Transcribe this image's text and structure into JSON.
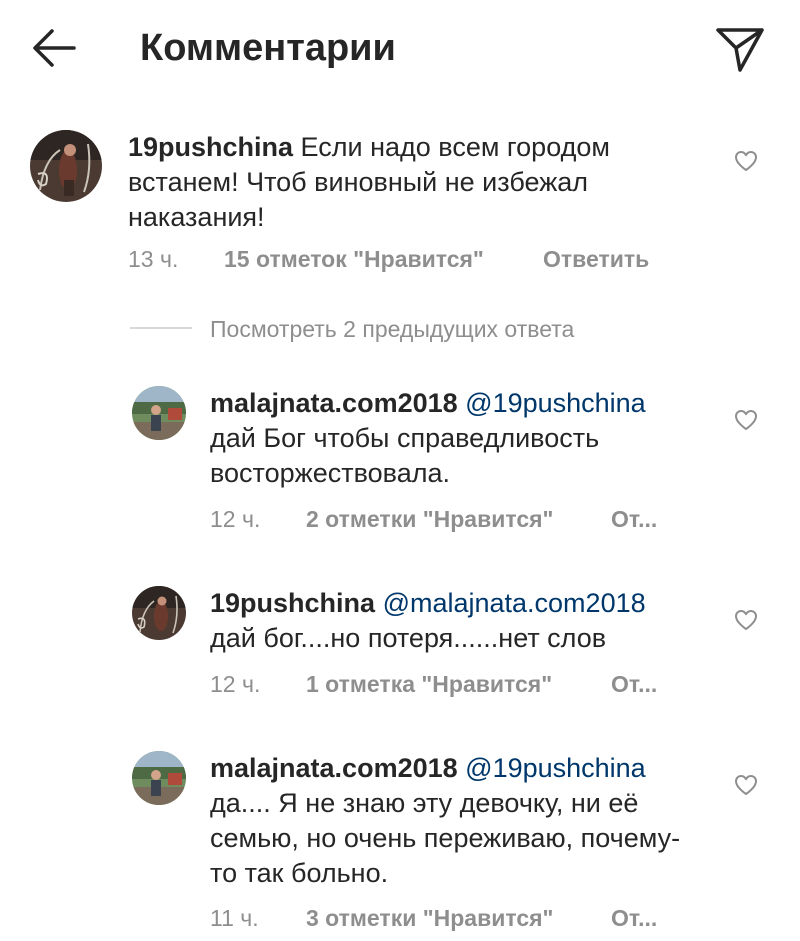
{
  "header": {
    "title": "Комментарии",
    "back_icon": "arrow-left-icon",
    "send_icon": "paper-plane-icon"
  },
  "main_comment": {
    "username": "19pushchina",
    "text": " Если надо всем городом встанем! Чтоб виновный не избежал наказания!",
    "time": "13 ч.",
    "likes": "15 отметок \"Нравится\"",
    "reply_label": "Ответить"
  },
  "view_replies": "Посмотреть 2 предыдущих ответа",
  "replies": [
    {
      "username": "malajnata.com2018",
      "mention": "@19pushchina",
      "text": "дай  Бог чтобы справедливость восторжествовала.",
      "time": "12 ч.",
      "likes": "2 отметки \"Нравится\"",
      "reply_label": "От..."
    },
    {
      "username": "19pushchina",
      "mention": "@malajnata.com2018",
      "text": "дай бог....но потеря......нет слов",
      "time": "12 ч.",
      "likes": "1 отметка \"Нравится\"",
      "reply_label": "От..."
    },
    {
      "username": "malajnata.com2018",
      "mention": "@19pushchina",
      "text": "да.... Я не знаю эту девочку, ни её семью, но очень переживаю, почему-то так больно.",
      "time": "11 ч.",
      "likes": "3 отметки \"Нравится\"",
      "reply_label": "От..."
    }
  ],
  "colors": {
    "text": "#262626",
    "secondary": "#8e8e8e",
    "mention": "#00376b"
  }
}
